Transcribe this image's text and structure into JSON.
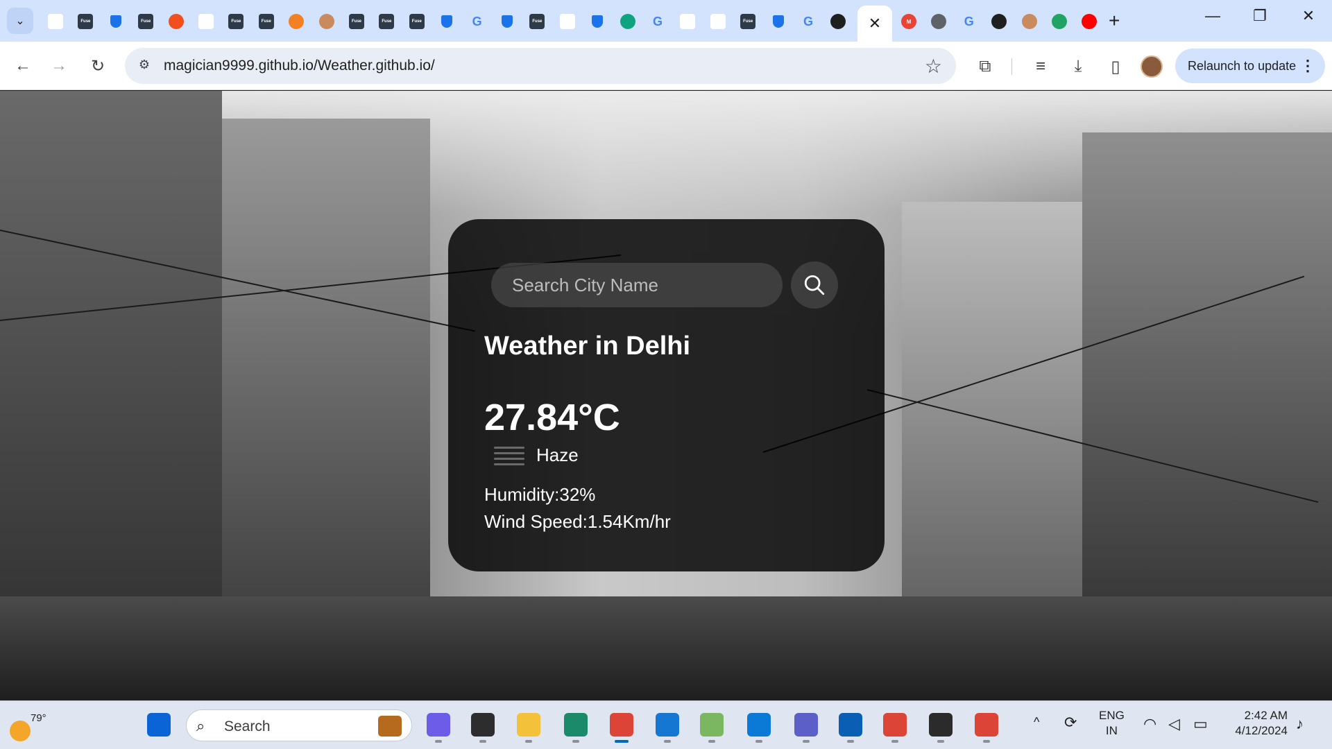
{
  "browser": {
    "tab_strip": {
      "tab_search_icon": "chevron-down-icon",
      "active_tab_close": "✕",
      "new_tab": "+",
      "window_controls": {
        "minimize": "—",
        "restore": "❐",
        "close": "✕"
      },
      "tabs": [
        {
          "icon": "pen-icon"
        },
        {
          "icon": "fuse-icon",
          "text": "Fuse"
        },
        {
          "icon": "shield-icon"
        },
        {
          "icon": "fuse-icon",
          "text": "Fuse"
        },
        {
          "icon": "figma-icon"
        },
        {
          "icon": "pen-icon"
        },
        {
          "icon": "fuse-icon",
          "text": "Fuse"
        },
        {
          "icon": "fuse-icon",
          "text": "Fuse"
        },
        {
          "icon": "stack-icon"
        },
        {
          "icon": "avatar-icon"
        },
        {
          "icon": "fuse-icon",
          "text": "Fuse"
        },
        {
          "icon": "fuse-icon",
          "text": "Fuse"
        },
        {
          "icon": "fuse-icon",
          "text": "Fuse"
        },
        {
          "icon": "shield-icon"
        },
        {
          "icon": "google-icon",
          "text": "G"
        },
        {
          "icon": "shield-icon"
        },
        {
          "icon": "fuse-icon",
          "text": "Fuse"
        },
        {
          "icon": "pen-icon"
        },
        {
          "icon": "shield-icon"
        },
        {
          "icon": "openai-icon"
        },
        {
          "icon": "google-icon",
          "text": "G"
        },
        {
          "icon": "pen-icon"
        },
        {
          "icon": "pen-icon"
        },
        {
          "icon": "fuse-icon",
          "text": "Fuse"
        },
        {
          "icon": "shield-icon"
        },
        {
          "icon": "google-icon",
          "text": "G"
        },
        {
          "icon": "github-icon"
        }
      ],
      "after_active_tabs": [
        {
          "icon": "gmail-icon",
          "text": "M"
        },
        {
          "icon": "chrome-icon"
        },
        {
          "icon": "google-icon",
          "text": "G"
        },
        {
          "icon": "github-icon"
        },
        {
          "icon": "avatar-icon"
        },
        {
          "icon": "drive-icon"
        },
        {
          "icon": "youtube-icon"
        }
      ]
    },
    "toolbar": {
      "url": "magician9999.github.io/Weather.github.io/",
      "relaunch_label": "Relaunch to update",
      "back": "←",
      "forward": "→",
      "reload": "↻",
      "site_info": "⚙",
      "bookmark": "☆",
      "extensions": "⧉",
      "media": "≡",
      "download": "⤓",
      "side_panel": "▯",
      "menu": "⋮"
    }
  },
  "weather": {
    "search_placeholder": "Search City Name",
    "city_heading": "Weather in Delhi",
    "temperature": "27.84°C",
    "description": "Haze",
    "humidity": "Humidity:32%",
    "wind": "Wind Speed:1.54Km/hr"
  },
  "taskbar": {
    "weather_temp": "79°",
    "search_label": "Search",
    "lang_line1": "ENG",
    "lang_line2": "IN",
    "time": "2:42 AM",
    "date": "4/12/2024",
    "chevron": "^",
    "apps": [
      {
        "name": "start-icon",
        "color": "#0a64d6"
      },
      {
        "name": "copilot-icon",
        "color": "#6c5ce7"
      },
      {
        "name": "task-view-icon",
        "color": "#2d2d2d"
      },
      {
        "name": "file-explorer-icon",
        "color": "#f3c13a"
      },
      {
        "name": "edge-beta-icon",
        "color": "#1b8a6b"
      },
      {
        "name": "chrome-icon",
        "color": "#db4437",
        "active": true
      },
      {
        "name": "vscode-icon",
        "color": "#1677d2"
      },
      {
        "name": "notepad-icon",
        "color": "#7bb661"
      },
      {
        "name": "edge-icon",
        "color": "#0b7ad6"
      },
      {
        "name": "teams-icon",
        "color": "#5b5fc7"
      },
      {
        "name": "outlook-icon",
        "color": "#0a5fb4"
      },
      {
        "name": "chrome-profile-icon",
        "color": "#db4437"
      },
      {
        "name": "terminal-icon",
        "color": "#2b2b2b"
      },
      {
        "name": "chrome-dev-icon",
        "color": "#db4437"
      }
    ]
  }
}
